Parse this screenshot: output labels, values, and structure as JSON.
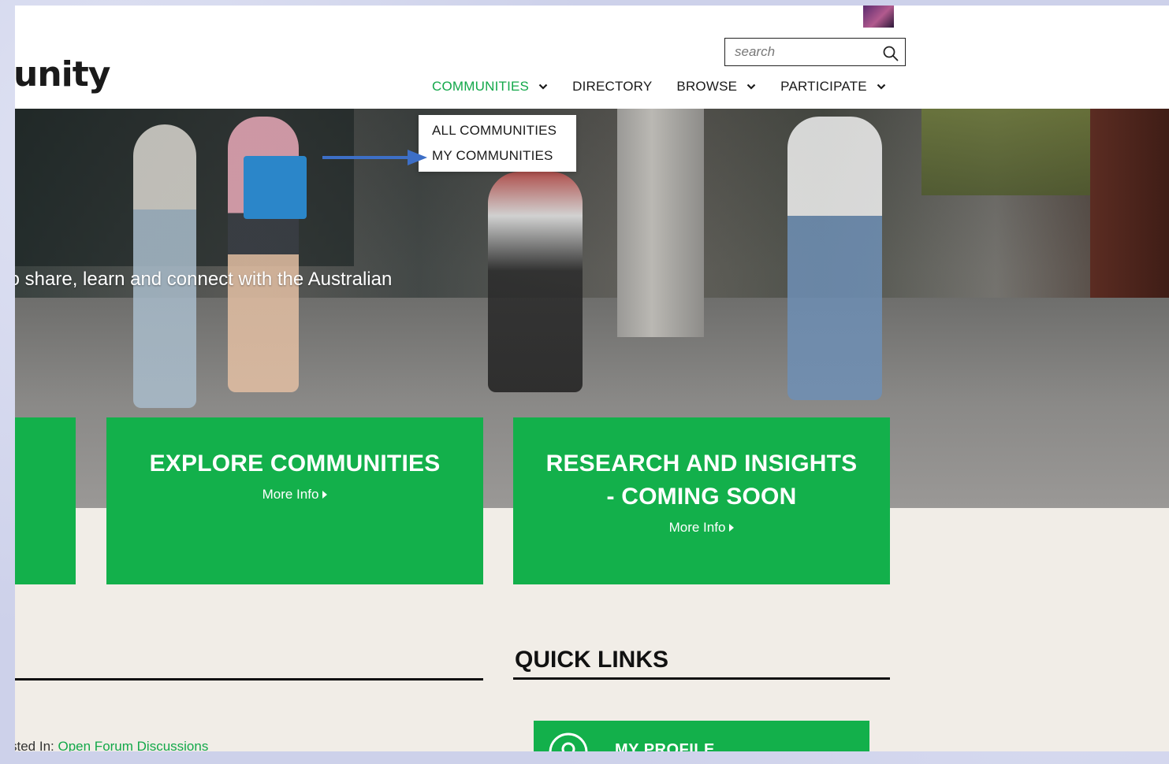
{
  "header": {
    "logo_text": "unity",
    "search_placeholder": "search",
    "nav": [
      {
        "label": "COMMUNITIES"
      },
      {
        "label": "DIRECTORY"
      },
      {
        "label": "BROWSE"
      },
      {
        "label": "PARTICIPATE"
      }
    ]
  },
  "dropdown": {
    "items": [
      {
        "label": "ALL COMMUNITIES"
      },
      {
        "label": "MY COMMUNITIES"
      }
    ]
  },
  "hero": {
    "tagline": "to share, learn and connect with the Australian"
  },
  "cards": [
    {
      "title_lines": [
        "EXPLORE COMMUNITIES"
      ],
      "more": "More Info"
    },
    {
      "title_lines": [
        "RESEARCH AND INSIGHTS",
        "- COMING SOON"
      ],
      "more": "More Info"
    }
  ],
  "quick_links": {
    "title": "QUICK LINKS",
    "items": [
      {
        "label": "MY PROFILE"
      }
    ]
  },
  "feed": {
    "posted_in_label": "sted In:",
    "posted_in_link": "Open Forum Discussions"
  },
  "colors": {
    "accent_green": "#13b04b",
    "nav_active": "#13a84a",
    "annotation_arrow": "#3d6fc7"
  }
}
